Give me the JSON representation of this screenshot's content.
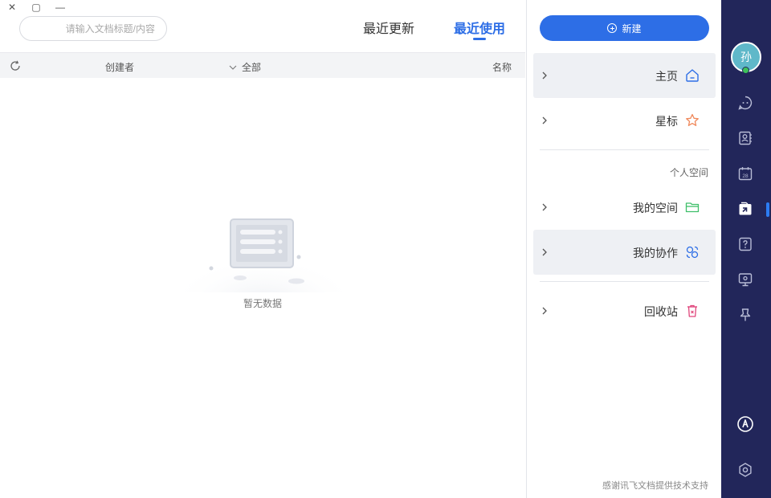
{
  "window": {
    "close": "✕",
    "maximize": "▢",
    "minimize": "—"
  },
  "search": {
    "placeholder": "请输入文档标题/内容",
    "value": ""
  },
  "tabs": [
    {
      "label": "最近使用",
      "active": true
    },
    {
      "label": "最近更新",
      "active": false
    }
  ],
  "table": {
    "columns": {
      "name": "名称",
      "filter": "全部",
      "creator": "创建者"
    },
    "rows": []
  },
  "empty_state": {
    "text": "暂无数据"
  },
  "sidebar": {
    "new_button": "新建",
    "items": [
      {
        "label": "主页",
        "icon": "home-icon",
        "selected": true
      },
      {
        "label": "星标",
        "icon": "star-icon",
        "selected": false
      }
    ],
    "personal_section": {
      "title": "个人空间",
      "items": [
        {
          "label": "我的空间",
          "icon": "folder-icon",
          "selected": false
        },
        {
          "label": "我的协作",
          "icon": "collaboration-icon",
          "selected": true
        }
      ]
    },
    "trash": {
      "label": "回收站",
      "icon": "trash-icon"
    },
    "footer": "感谢讯飞文档提供技术支持"
  },
  "rail": {
    "avatar_text": "孙",
    "status": "online",
    "icons": [
      "chat-icon",
      "contacts-icon",
      "calendar-icon",
      "documents-icon",
      "help-icon",
      "screen-share-icon",
      "pin-icon",
      "brand-icon",
      "settings-icon"
    ],
    "calendar_day": "28",
    "active": "documents-icon"
  },
  "colors": {
    "accent": "#2d6ee6",
    "rail_bg": "#22265a",
    "online": "#3ec25a",
    "star": "#f08a5d",
    "folder": "#3fbf6a",
    "trash": "#e0457b"
  }
}
